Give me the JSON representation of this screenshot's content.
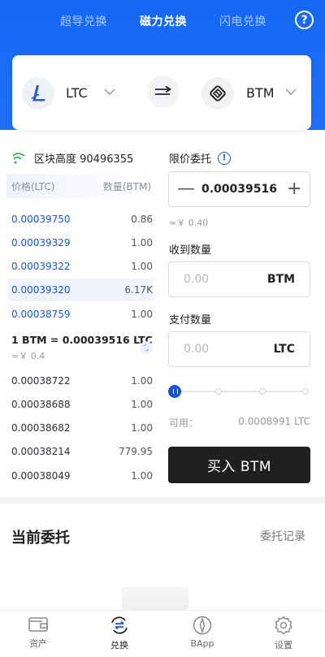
{
  "header": {
    "tabs": [
      {
        "label": "超导兑换",
        "active": false
      },
      {
        "label": "磁力兑换",
        "active": true
      },
      {
        "label": "闪电兑换",
        "active": false
      }
    ],
    "help_icon": "?"
  },
  "pair": {
    "from": {
      "symbol": "LTC",
      "icon": "litecoin-logo"
    },
    "to": {
      "symbol": "BTM",
      "icon": "bytom-logo"
    },
    "swap_icon": "double-arrow-right"
  },
  "orderbook": {
    "block_height_label": "区块高度 90496355",
    "headers": {
      "price": "价格(LTC)",
      "qty": "数量(BTM)"
    },
    "asks": [
      {
        "price": "0.00039750",
        "qty": "0.86"
      },
      {
        "price": "0.00039329",
        "qty": "1.00"
      },
      {
        "price": "0.00039322",
        "qty": "1.00"
      },
      {
        "price": "0.00039320",
        "qty": "6.17K",
        "highlight": true
      },
      {
        "price": "0.00038759",
        "qty": "1.00"
      }
    ],
    "mid": {
      "price": "1 BTM = 0.00039516 LTC",
      "fiat": "≈￥ 0.4"
    },
    "bids": [
      {
        "price": "0.00038722",
        "qty": "1.00"
      },
      {
        "price": "0.00038688",
        "qty": "1.00"
      },
      {
        "price": "0.00038682",
        "qty": "1.00"
      },
      {
        "price": "0.00038214",
        "qty": "779.95"
      },
      {
        "price": "0.00038049",
        "qty": "1.00"
      }
    ]
  },
  "form": {
    "limit_label": "限价委托",
    "info_icon": "!",
    "price_value": "0.00039516",
    "minus": "—",
    "plus": "+",
    "approx": "≈￥ 0.40",
    "receive_label": "收到数量",
    "receive_placeholder": "0.00",
    "receive_unit": "BTM",
    "pay_label": "支付数量",
    "pay_placeholder": "0.00",
    "pay_unit": "LTC",
    "slider_percent": 0,
    "available_label": "可用：",
    "available_value": "0.0008991 LTC",
    "buy_button": "买入 BTM"
  },
  "orders": {
    "title": "当前委托",
    "history_link": "委托记录"
  },
  "nav": [
    {
      "label": "资产",
      "icon": "wallet-icon",
      "active": false
    },
    {
      "label": "兑换",
      "icon": "exchange-icon",
      "active": true
    },
    {
      "label": "BApp",
      "icon": "compass-icon",
      "active": false
    },
    {
      "label": "设置",
      "icon": "gear-icon",
      "active": false
    }
  ],
  "colors": {
    "header_blue": "#1668f3",
    "price_blue": "#1a55c8",
    "buy_button_bg": "#202020"
  }
}
